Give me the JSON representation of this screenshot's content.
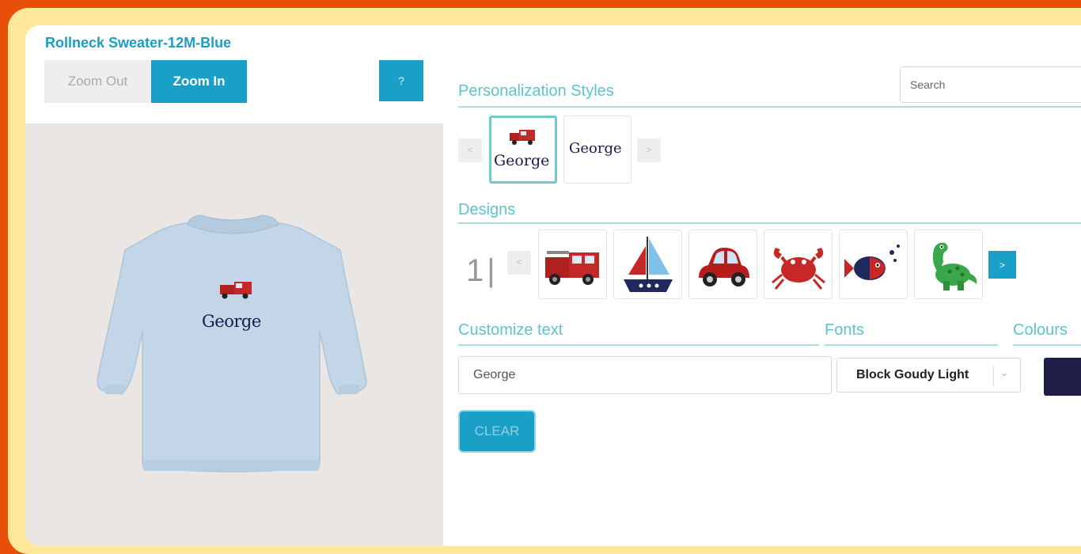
{
  "product": {
    "title": "Rollneck Sweater-12M-Blue"
  },
  "toolbar": {
    "zoom_out": "Zoom Out",
    "zoom_in": "Zoom In",
    "help": "?"
  },
  "preview": {
    "garment_text": "George",
    "motif_icon": "fire-truck-icon"
  },
  "personalization": {
    "title": "Personalization Styles",
    "search_placeholder": "Search",
    "prev_icon": "<",
    "next_icon": ">",
    "styles": [
      {
        "text": "George",
        "icon": "fire-truck-icon",
        "selected": true
      },
      {
        "text": "George",
        "selected": false
      }
    ]
  },
  "designs": {
    "title": "Designs",
    "counter": "1|",
    "prev_icon": "<",
    "next_icon": ">",
    "items": [
      {
        "icon": "fire-truck-icon"
      },
      {
        "icon": "sailboat-icon"
      },
      {
        "icon": "car-icon"
      },
      {
        "icon": "crab-icon"
      },
      {
        "icon": "fish-icon"
      },
      {
        "icon": "dinosaur-icon"
      }
    ]
  },
  "customize": {
    "text_label": "Customize text",
    "text_value": "George",
    "fonts_label": "Fonts",
    "font_value": "Block Goudy Light",
    "colours_label": "Colours",
    "colour_value": "#1e1e48",
    "clear_label": "CLEAR"
  }
}
